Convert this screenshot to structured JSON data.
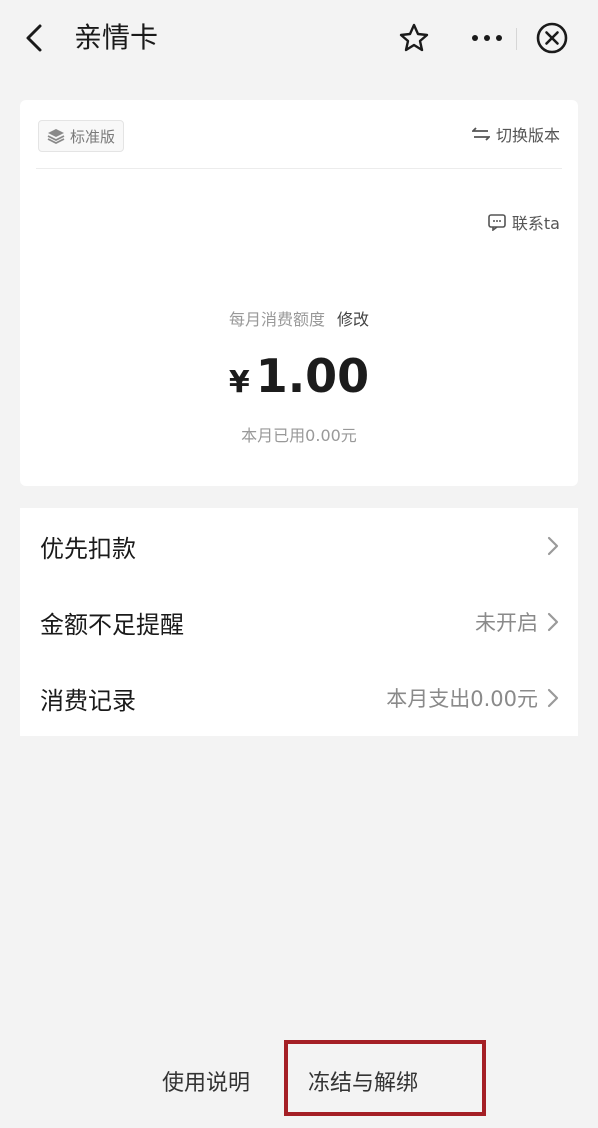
{
  "header": {
    "title": "亲情卡"
  },
  "card": {
    "badge": "标准版",
    "switch_label": "切换版本",
    "contact_label": "联系ta",
    "limit_label": "每月消费额度",
    "modify_label": "修改",
    "currency": "¥",
    "amount": "1.00",
    "used_text": "本月已用0.00元"
  },
  "list": {
    "items": [
      {
        "label": "优先扣款",
        "value": ""
      },
      {
        "label": "金额不足提醒",
        "value": "未开启"
      },
      {
        "label": "消费记录",
        "value": "本月支出0.00元"
      }
    ]
  },
  "footer": {
    "usage_label": "使用说明",
    "freeze_label": "冻结与解绑"
  },
  "colors": {
    "background": "#f3f3f3",
    "card": "#ffffff",
    "highlight_box": "#a41f25"
  },
  "icons": [
    "back-arrow-icon",
    "star-icon",
    "more-icon",
    "close-circle-icon",
    "layers-icon",
    "swap-icon",
    "chat-icon",
    "chevron-right-icon"
  ]
}
